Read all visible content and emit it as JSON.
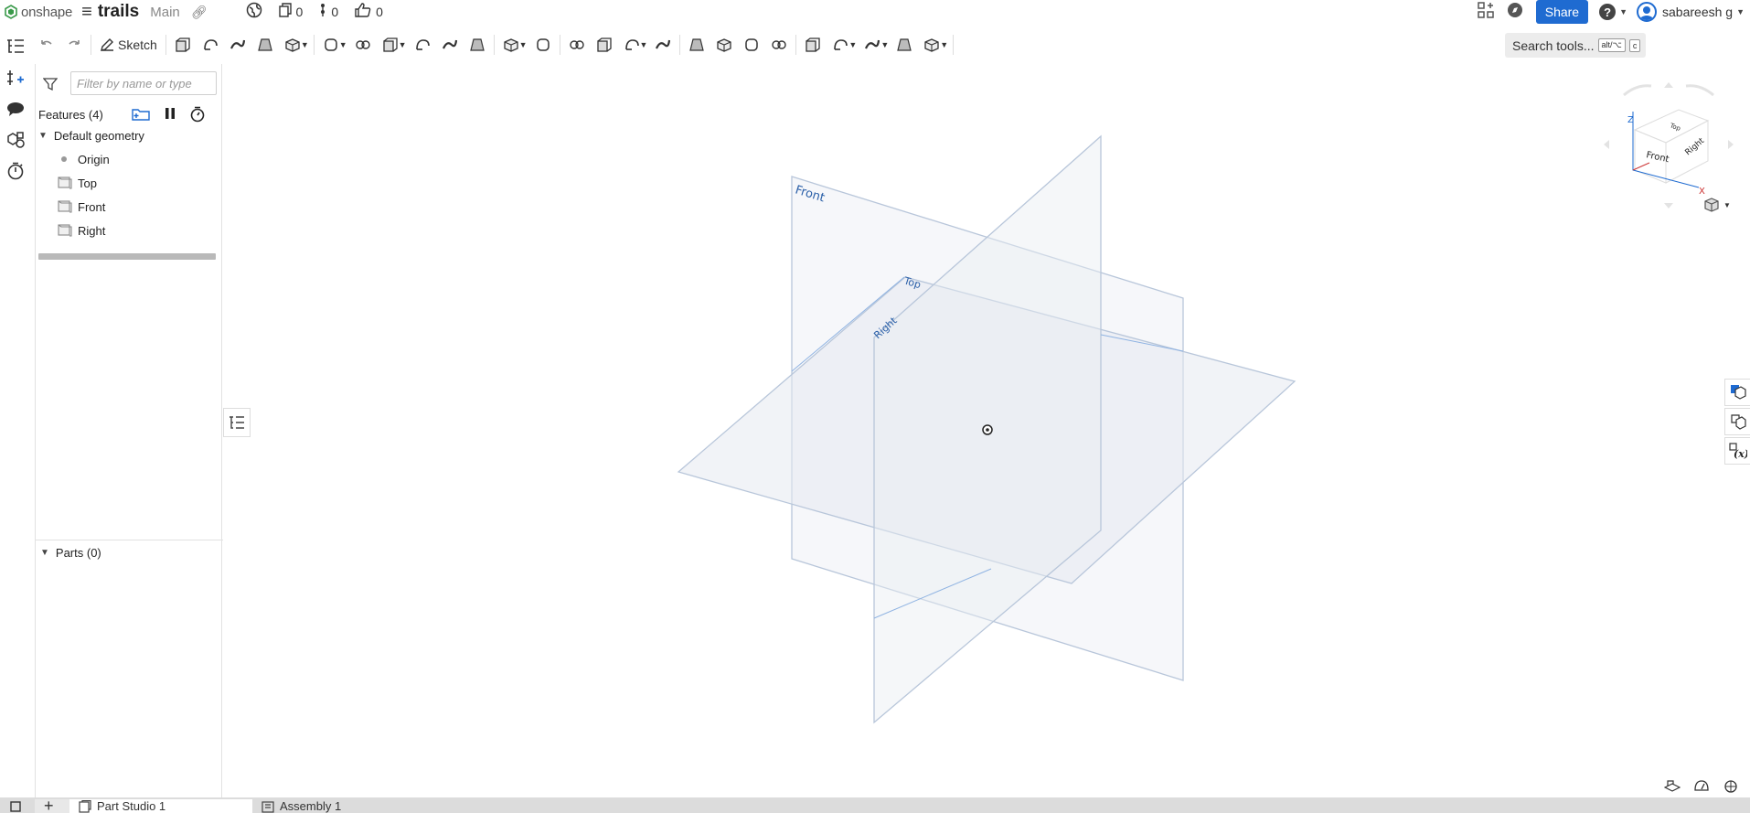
{
  "header": {
    "logo_text": "onshape",
    "document_name": "trails",
    "branch": "Main",
    "versions_count": "0",
    "branches_count": "0",
    "likes_count": "0",
    "share_label": "Share",
    "user_name": "sabareesh g"
  },
  "toolbar": {
    "sketch_label": "Sketch",
    "search_label": "Search tools...",
    "search_shortcut": "alt/⌥",
    "search_key": "c",
    "icons": [
      "undo-icon",
      "redo-icon",
      "sketch-icon",
      "extrude-icon",
      "revolve-icon",
      "sweep-icon",
      "loft-icon",
      "thicken-icon",
      "fillet-icon",
      "chamfer-icon",
      "draft-icon",
      "rib-icon",
      "shell-icon",
      "hole-icon",
      "linear-pattern-icon",
      "mirror-icon",
      "boolean-icon",
      "split-icon",
      "transform-icon",
      "delete-part-icon",
      "modify-fillet-icon",
      "delete-face-icon",
      "move-face-icon",
      "replace-face-icon",
      "plane-icon",
      "mate-connector-icon",
      "variable-icon",
      "configure-icon",
      "appearance-icon"
    ]
  },
  "features": {
    "filter_placeholder": "Filter by name or type",
    "title": "Features (4)",
    "group_label": "Default geometry",
    "items": [
      {
        "label": "Origin",
        "type": "origin"
      },
      {
        "label": "Top",
        "type": "plane"
      },
      {
        "label": "Front",
        "type": "plane"
      },
      {
        "label": "Right",
        "type": "plane"
      }
    ]
  },
  "parts": {
    "title": "Parts (0)"
  },
  "viewport": {
    "plane_labels": {
      "front": "Front",
      "top": "Top",
      "right": "Right"
    },
    "view_cube": {
      "top": "Top",
      "front": "Front",
      "right": "Right",
      "axis_x": "X",
      "axis_z": "Z"
    }
  },
  "tabs": [
    {
      "label": "Part Studio 1",
      "active": true
    },
    {
      "label": "Assembly 1",
      "active": false
    }
  ],
  "colors": {
    "accent": "#1f6bd1",
    "plane_edge": "#b8c6da",
    "plane_fill": "#e6eaf0"
  }
}
